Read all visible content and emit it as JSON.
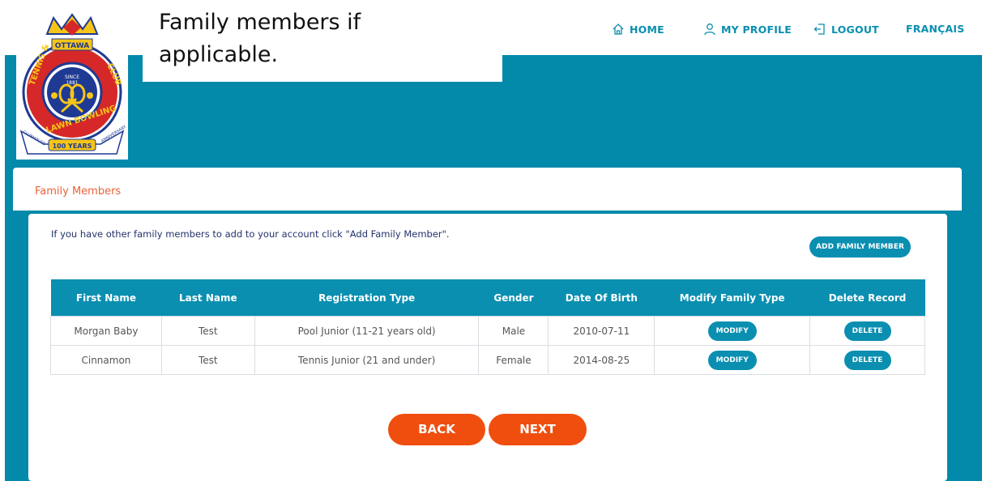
{
  "callout": {
    "text": "Family members if applicable."
  },
  "nav": {
    "home": "HOME",
    "profile": "MY PROFILE",
    "logout": "LOGOUT",
    "language": "FRANÇAIS"
  },
  "logo": {
    "top_text": "OTTAWA",
    "since": "SINCE",
    "year": "1881",
    "left_arc": "TENNIS &",
    "bottom_arc": "LAWN BOWLING",
    "right_arc": "CLUB",
    "ribbon": "100 YEARS",
    "ribbon_left": "CLUBHOUSE",
    "ribbon_right": "ANNIVERSARY"
  },
  "panel": {
    "title": "Family Members",
    "info": "If you have other family members to add to your account click \"Add Family Member\".",
    "add_button": "ADD FAMILY MEMBER"
  },
  "table": {
    "headers": [
      "First Name",
      "Last Name",
      "Registration Type",
      "Gender",
      "Date Of Birth",
      "Modify Family Type",
      "Delete Record"
    ],
    "rows": [
      {
        "first": "Morgan Baby",
        "last": "Test",
        "type": "Pool Junior (11-21 years old)",
        "gender": "Male",
        "dob": "2010-07-11",
        "modify": "MODIFY",
        "delete": "DELETE"
      },
      {
        "first": "Cinnamon",
        "last": "Test",
        "type": "Tennis Junior (21 and under)",
        "gender": "Female",
        "dob": "2014-08-25",
        "modify": "MODIFY",
        "delete": "DELETE"
      }
    ]
  },
  "footer": {
    "back": "BACK",
    "next": "NEXT"
  },
  "colors": {
    "teal": "#0389aa",
    "button_blue": "#0a8fb0",
    "orange": "#f04e0f",
    "title_orange": "#e8633a"
  }
}
